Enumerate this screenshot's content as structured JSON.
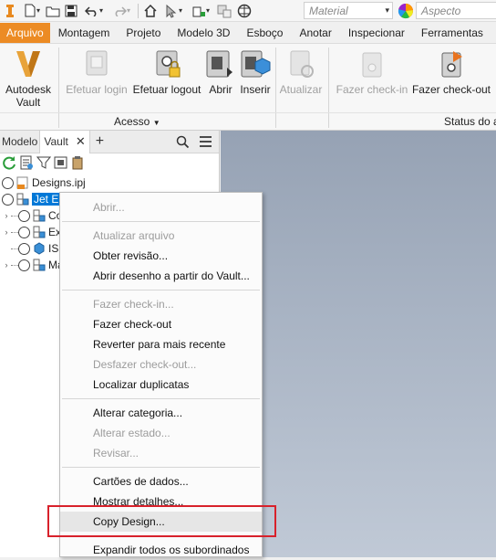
{
  "app": {
    "name": "Autodesk Inventor"
  },
  "qat": {
    "material_placeholder": "Material",
    "appearance_placeholder": "Aspecto"
  },
  "ribbon_tabs": [
    "Arquivo",
    "Montagem",
    "Projeto",
    "Modelo 3D",
    "Esboço",
    "Anotar",
    "Inspecionar",
    "Ferramentas"
  ],
  "ribbon": {
    "vault_button": "Autodesk Vault",
    "login": "Efetuar login",
    "logout": "Efetuar logout",
    "open": "Abrir",
    "insert": "Inserir",
    "refresh": "Atualizar",
    "checkin": "Fazer check-in",
    "checkout": "Fazer check-out",
    "panel_access": "Acesso",
    "panel_status": "Status do a"
  },
  "browser": {
    "tab_model": "Modelo",
    "tab_vault": "Vault",
    "tree": [
      {
        "label": "Designs.ipj"
      },
      {
        "label": "Jet E"
      },
      {
        "label": "Co"
      },
      {
        "label": "Ex"
      },
      {
        "label": "IS"
      },
      {
        "label": "Ma"
      }
    ]
  },
  "context_menu": {
    "items": [
      {
        "label": "Abrir...",
        "enabled": false
      },
      {
        "label": "Atualizar arquivo",
        "enabled": false
      },
      {
        "label": "Obter revisão...",
        "enabled": true
      },
      {
        "label": "Abrir desenho a partir do Vault...",
        "enabled": true
      },
      {
        "label": "Fazer check-in...",
        "enabled": false
      },
      {
        "label": "Fazer check-out",
        "enabled": true
      },
      {
        "label": "Reverter para mais recente",
        "enabled": true
      },
      {
        "label": "Desfazer check-out...",
        "enabled": false
      },
      {
        "label": "Localizar duplicatas",
        "enabled": true
      },
      {
        "label": "Alterar categoria...",
        "enabled": true
      },
      {
        "label": "Alterar estado...",
        "enabled": false
      },
      {
        "label": "Revisar...",
        "enabled": false
      },
      {
        "label": "Cartões de dados...",
        "enabled": true
      },
      {
        "label": "Mostrar detalhes...",
        "enabled": true
      },
      {
        "label": "Copy Design...",
        "enabled": true
      },
      {
        "label": "Expandir todos os subordinados",
        "enabled": true
      }
    ]
  },
  "colors": {
    "file_tab": "#ec8b24",
    "highlight_box": "#d8212b",
    "selection": "#0078d7"
  }
}
